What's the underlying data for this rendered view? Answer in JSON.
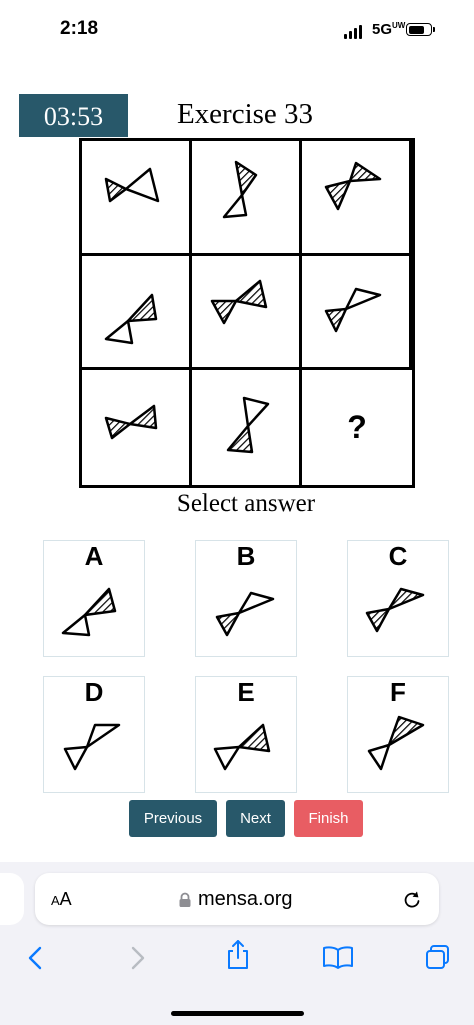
{
  "status_bar": {
    "time": "2:18",
    "network": "5G",
    "network_sub": "UW",
    "battery_level": 0.75
  },
  "header": {
    "timer": "03:53",
    "title": "Exercise 33"
  },
  "puzzle": {
    "missing_cell_label": "?",
    "cells": [
      "pattern-1",
      "pattern-2",
      "pattern-3",
      "pattern-4",
      "pattern-5",
      "pattern-6",
      "pattern-7",
      "pattern-8",
      "missing"
    ]
  },
  "answers": {
    "prompt": "Select answer",
    "options": [
      {
        "letter": "A"
      },
      {
        "letter": "B"
      },
      {
        "letter": "C"
      },
      {
        "letter": "D"
      },
      {
        "letter": "E"
      },
      {
        "letter": "F"
      }
    ]
  },
  "nav": {
    "previous": "Previous",
    "next": "Next",
    "finish": "Finish"
  },
  "colors": {
    "timer_bg": "#28586a",
    "nav_button": "#28586a",
    "finish_button": "#e85d63",
    "toolbar_icon": "#0a7aff"
  },
  "browser": {
    "text_size_label_small": "A",
    "text_size_label_large": "A",
    "url": "mensa.org",
    "icons": [
      "lock-icon",
      "reload-icon",
      "back-icon",
      "forward-icon",
      "share-icon",
      "bookmarks-icon",
      "tabs-icon"
    ]
  }
}
